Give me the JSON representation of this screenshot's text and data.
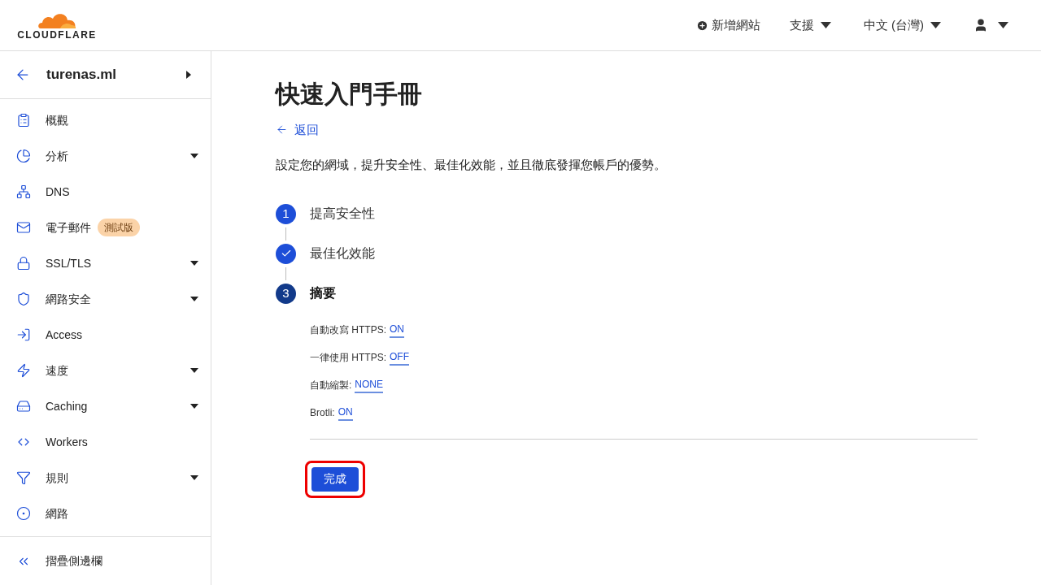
{
  "header": {
    "logo_text": "CLOUDFLARE",
    "add_site": "新增網站",
    "support": "支援",
    "language": "中文 (台灣)"
  },
  "sidebar": {
    "domain": "turenas.ml",
    "items": [
      {
        "label": "概觀",
        "has_menu": false
      },
      {
        "label": "分析",
        "has_menu": true
      },
      {
        "label": "DNS",
        "has_menu": false
      },
      {
        "label": "電子郵件",
        "has_menu": false,
        "badge": "測試版"
      },
      {
        "label": "SSL/TLS",
        "has_menu": true
      },
      {
        "label": "網路安全",
        "has_menu": true
      },
      {
        "label": "Access",
        "has_menu": false
      },
      {
        "label": "速度",
        "has_menu": true
      },
      {
        "label": "Caching",
        "has_menu": true
      },
      {
        "label": "Workers",
        "has_menu": false
      },
      {
        "label": "規則",
        "has_menu": true
      },
      {
        "label": "網路",
        "has_menu": false
      }
    ],
    "collapse": "摺疊側邊欄"
  },
  "main": {
    "title": "快速入門手冊",
    "back": "返回",
    "intro": "設定您的網域，提升安全性、最佳化效能，並且徹底發揮您帳戶的優勢。",
    "steps": [
      {
        "marker": "1",
        "label": "提高安全性",
        "done": false,
        "active": false
      },
      {
        "label": "最佳化效能",
        "done": true,
        "active": false
      },
      {
        "marker": "3",
        "label": "摘要",
        "done": false,
        "active": true
      }
    ],
    "settings": [
      {
        "label": "自動改寫 HTTPS:",
        "value": "ON"
      },
      {
        "label": "一律使用 HTTPS:",
        "value": "OFF"
      },
      {
        "label": "自動縮製:",
        "value": "NONE"
      },
      {
        "label": "Brotli:",
        "value": "ON"
      }
    ],
    "finish": "完成",
    "finish_highlighted": true
  }
}
